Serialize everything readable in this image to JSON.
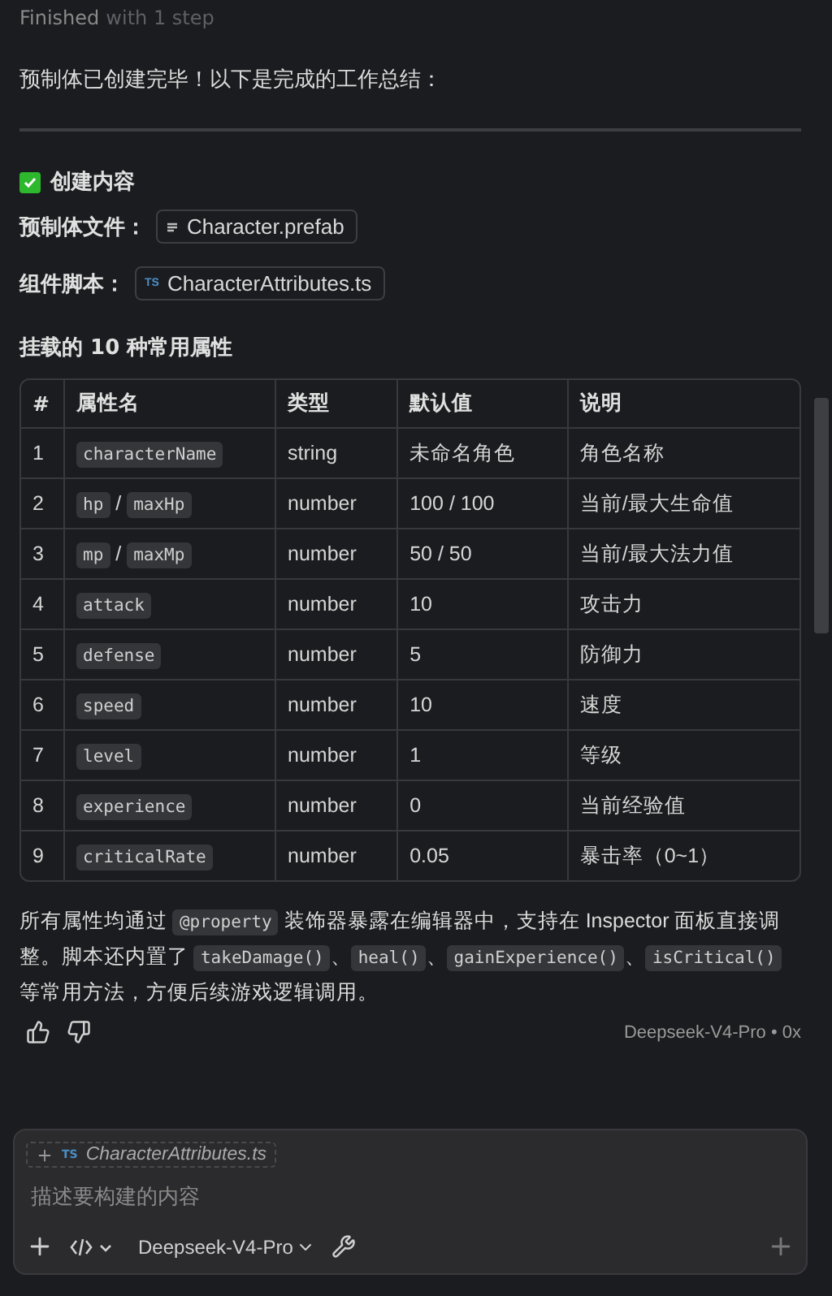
{
  "status": {
    "label": "Finished",
    "detail": "with 1 step"
  },
  "intro": "预制体已创建完毕！以下是完成的工作总结：",
  "section": {
    "checked": true,
    "title": "创建内容"
  },
  "files": [
    {
      "label": "预制体文件：",
      "kind": "prefab",
      "name": "Character.prefab"
    },
    {
      "label": "组件脚本：",
      "kind": "ts",
      "badge": "TS",
      "name": "CharacterAttributes.ts"
    }
  ],
  "table_title": "挂载的 10 种常用属性",
  "table": {
    "columns": [
      "#",
      "属性名",
      "类型",
      "默认值",
      "说明"
    ],
    "rows": [
      {
        "index": "1",
        "name": [
          {
            "kind": "code",
            "text": "characterName"
          }
        ],
        "type": "string",
        "default": "未命名角色",
        "desc": "角色名称"
      },
      {
        "index": "2",
        "name": [
          {
            "kind": "code",
            "text": "hp"
          },
          {
            "kind": "text",
            "text": " / "
          },
          {
            "kind": "code",
            "text": "maxHp"
          }
        ],
        "type": "number",
        "default": "100 / 100",
        "desc": "当前/最大生命值"
      },
      {
        "index": "3",
        "name": [
          {
            "kind": "code",
            "text": "mp"
          },
          {
            "kind": "text",
            "text": " / "
          },
          {
            "kind": "code",
            "text": "maxMp"
          }
        ],
        "type": "number",
        "default": "50 / 50",
        "desc": "当前/最大法力值"
      },
      {
        "index": "4",
        "name": [
          {
            "kind": "code",
            "text": "attack"
          }
        ],
        "type": "number",
        "default": "10",
        "desc": "攻击力"
      },
      {
        "index": "5",
        "name": [
          {
            "kind": "code",
            "text": "defense"
          }
        ],
        "type": "number",
        "default": "5",
        "desc": "防御力"
      },
      {
        "index": "6",
        "name": [
          {
            "kind": "code",
            "text": "speed"
          }
        ],
        "type": "number",
        "default": "10",
        "desc": "速度"
      },
      {
        "index": "7",
        "name": [
          {
            "kind": "code",
            "text": "level"
          }
        ],
        "type": "number",
        "default": "1",
        "desc": "等级"
      },
      {
        "index": "8",
        "name": [
          {
            "kind": "code",
            "text": "experience"
          }
        ],
        "type": "number",
        "default": "0",
        "desc": "当前经验值"
      },
      {
        "index": "9",
        "name": [
          {
            "kind": "code",
            "text": "criticalRate"
          }
        ],
        "type": "number",
        "default": "0.05",
        "desc": "暴击率（0~1）"
      }
    ]
  },
  "summary": [
    {
      "kind": "text",
      "text": "所有属性均通过 "
    },
    {
      "kind": "code",
      "text": "@property"
    },
    {
      "kind": "text",
      "text": " 装饰器暴露在编辑器中，支持在 Inspector 面板直接调整。脚本还内置了 "
    },
    {
      "kind": "code",
      "text": "takeDamage()"
    },
    {
      "kind": "text",
      "text": "、"
    },
    {
      "kind": "code",
      "text": "heal()"
    },
    {
      "kind": "text",
      "text": "、"
    },
    {
      "kind": "code",
      "text": "gainExperience()"
    },
    {
      "kind": "text",
      "text": "、"
    },
    {
      "kind": "code",
      "text": "isCritical()"
    },
    {
      "kind": "text",
      "text": " 等常用方法，方便后续游戏逻辑调用。"
    }
  ],
  "meta": "Deepseek-V4-Pro • 0x",
  "composer": {
    "attachment": {
      "badge": "TS",
      "name": "CharacterAttributes.ts"
    },
    "placeholder": "描述要构建的内容",
    "model": "Deepseek-V4-Pro"
  }
}
